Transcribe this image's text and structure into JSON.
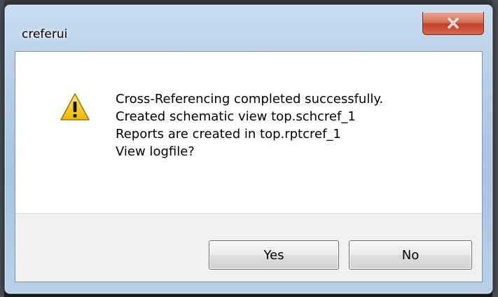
{
  "window": {
    "title": "creferui",
    "close_icon": "close-icon"
  },
  "message": {
    "icon": "warning-icon",
    "lines": [
      "Cross-Referencing completed successfully.",
      "Created schematic view top.schcref_1",
      "Reports are created in top.rptcref_1",
      "View logfile?"
    ]
  },
  "buttons": {
    "yes_label": "Yes",
    "no_label": "No"
  },
  "colors": {
    "titlebar_accent": "#b5cde6",
    "close_button": "#c2412a",
    "warning_fill": "#f5c400"
  }
}
